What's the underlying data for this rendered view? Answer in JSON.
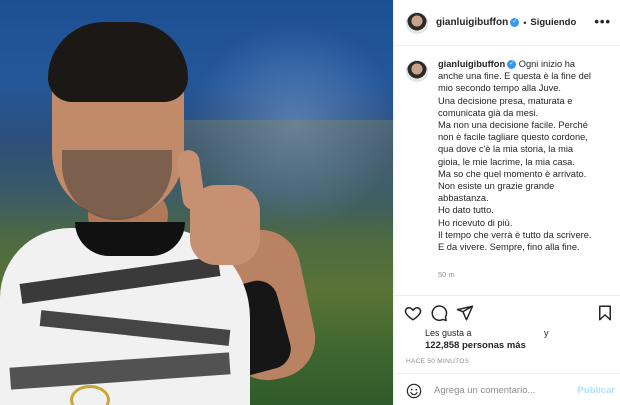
{
  "post": {
    "username": "gianluigibuffon",
    "follow_status": "Siguiendo",
    "separator": "•",
    "more_label": "•••",
    "caption_lines": [
      "Ogni inizio ha",
      "anche una fine. E questa è la fine del",
      "mio secondo tempo alla Juve.",
      "Una decisione presa, maturata e",
      "comunicata già da mesi.",
      "Ma non una decisione facile. Perché",
      "non è facile tagliare questo cordone,",
      "qua dove c'è la mia storia, la mia",
      "gioia, le mie lacrime, la mia casa.",
      "Ma so che quel momento è arrivato.",
      "Non esiste un grazie grande",
      "abbastanza.",
      "Ho dato tutto.",
      "Ho ricevuto di più.",
      "Il tempo che verrà è tutto da scrivere.",
      "E da vivere. Sempre, fino alla fine."
    ],
    "caption_time": "50 m",
    "likes_label": "Les gusta a",
    "likes_and": "y",
    "likes_count": "122,858 personas más",
    "posted_ago": "HACE 50 MINUTOS"
  },
  "comment": {
    "placeholder": "Agrega un comentario...",
    "publish_label": "Publicar"
  },
  "icons": {
    "verified": "verified-badge-icon",
    "like": "heart-icon",
    "comment": "comment-bubble-icon",
    "share": "paper-plane-icon",
    "save": "bookmark-icon",
    "emoji": "smiley-icon"
  },
  "colors": {
    "verified": "#3897f0",
    "publish_disabled": "#b2dffc",
    "muted_text": "#8e8e8e"
  }
}
